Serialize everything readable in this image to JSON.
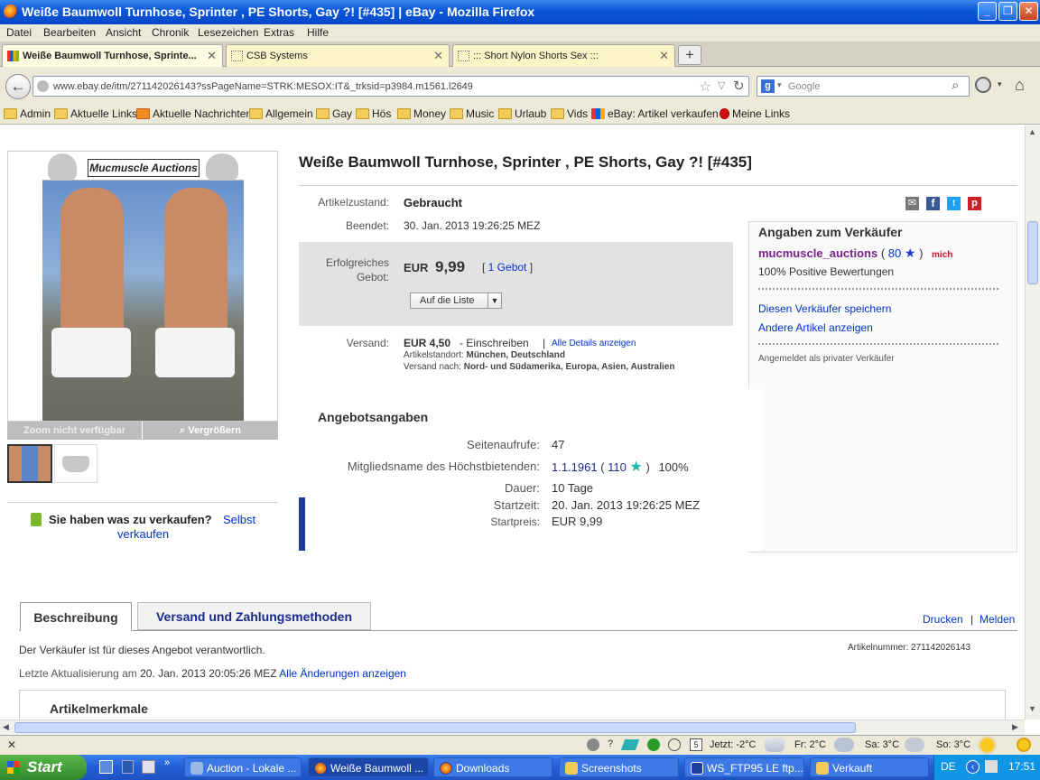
{
  "window": {
    "title": "Weiße Baumwoll Turnhose, Sprinter , PE Shorts, Gay ?! [#435] | eBay - Mozilla Firefox"
  },
  "menu": [
    "Datei",
    "Bearbeiten",
    "Ansicht",
    "Chronik",
    "Lesezeichen",
    "Extras",
    "Hilfe"
  ],
  "tabs": [
    {
      "label": "Weiße Baumwoll Turnhose, Sprinte..."
    },
    {
      "label": "CSB Systems"
    },
    {
      "label": "::: Short Nylon Shorts Sex :::"
    }
  ],
  "nav": {
    "url": "www.ebay.de/itm/271142026143?ssPageName=STRK:MESOX:IT&_trksid=p3984.m1561.l2649",
    "search_placeholder": "Google"
  },
  "bookmarks": [
    "Admin",
    "Aktuelle Links",
    "Aktuelle Nachrichten",
    "Allgemein",
    "Gay",
    "Hös",
    "Money",
    "Music",
    "Urlaub",
    "Vids",
    "eBay: Artikel verkaufen",
    "Meine Links"
  ],
  "item": {
    "banner": "Mucmuscle Auctions",
    "zoom_unavailable": "Zoom nicht verfügbar",
    "enlarge": "Vergrößern",
    "sell_prompt": "Sie haben was zu verkaufen?",
    "sell_link_1": "Selbst",
    "sell_link_2": "verkaufen",
    "title": "Weiße Baumwoll Turnhose, Sprinter , PE Shorts, Gay ?! [#435]",
    "condition_label": "Artikelzustand:",
    "condition": "Gebraucht",
    "ended_label": "Beendet:",
    "ended": "30. Jan. 2013 19:26:25 MEZ",
    "bid_label_1": "Erfolgreiches",
    "bid_label_2": "Gebot:",
    "currency": "EUR",
    "price": "9,99",
    "bids_link": "1 Gebot",
    "watch_button": "Auf die Liste",
    "shipping_label": "Versand:",
    "shipping_price": "EUR 4,50",
    "shipping_method": "- Einschreiben",
    "shipping_details": "Alle Details anzeigen",
    "location_label": "Artikelstandort:",
    "location": "München, Deutschland",
    "ships_to_label": "Versand nach:",
    "ships_to": "Nord- und Südamerika, Europa, Asien, Australien"
  },
  "offer": {
    "heading": "Angebotsangaben",
    "views_label": "Seitenaufrufe:",
    "views": "47",
    "bidder_label": "Mitgliedsname des Höchstbietenden:",
    "bidder": "1.1.1961",
    "bidder_score": "110",
    "bidder_pct": "100%",
    "duration_label": "Dauer:",
    "duration": "10 Tage",
    "start_label": "Startzeit:",
    "start": "20. Jan. 2013 19:26:25 MEZ",
    "startprice_label": "Startpreis:",
    "startprice": "EUR 9,99"
  },
  "seller": {
    "heading": "Angaben zum Verkäufer",
    "name": "mucmuscle_auctions",
    "score": "80",
    "me_badge": "mich",
    "positive": "100% Positive Bewertungen",
    "save_seller": "Diesen Verkäufer speichern",
    "other_items": "Andere Artikel anzeigen",
    "private": "Angemeldet als privater Verkäufer"
  },
  "lower": {
    "tab_description": "Beschreibung",
    "tab_shipping": "Versand und Zahlungsmethoden",
    "print": "Drucken",
    "report": "Melden",
    "responsibility": "Der Verkäufer ist für dieses Angebot verantwortlich.",
    "item_number_label": "Artikelnummer:",
    "item_number": "271142026143",
    "updated_label": "Letzte Aktualisierung am",
    "updated": "20. Jan. 2013 20:05:26 MEZ",
    "changes_link": "Alle Änderungen anzeigen",
    "features_heading": "Artikelmerkmale"
  },
  "status": {
    "weather_now": "Jetzt: -2°C",
    "weather_fr": "Fr: 2°C",
    "weather_sa": "Sa: 3°C",
    "weather_so": "So: 3°C"
  },
  "taskbar": {
    "start": "Start",
    "tasks": [
      "Auction - Lokale ...",
      "Weiße Baumwoll ...",
      "Downloads",
      "Screenshots",
      "WS_FTP95 LE ftp....",
      "Verkauft"
    ],
    "lang": "DE",
    "time": "17:51"
  },
  "colors": {
    "accent": "#0033cc",
    "seller_purple": "#7a1f8c",
    "taskbar": "#235dd4"
  }
}
